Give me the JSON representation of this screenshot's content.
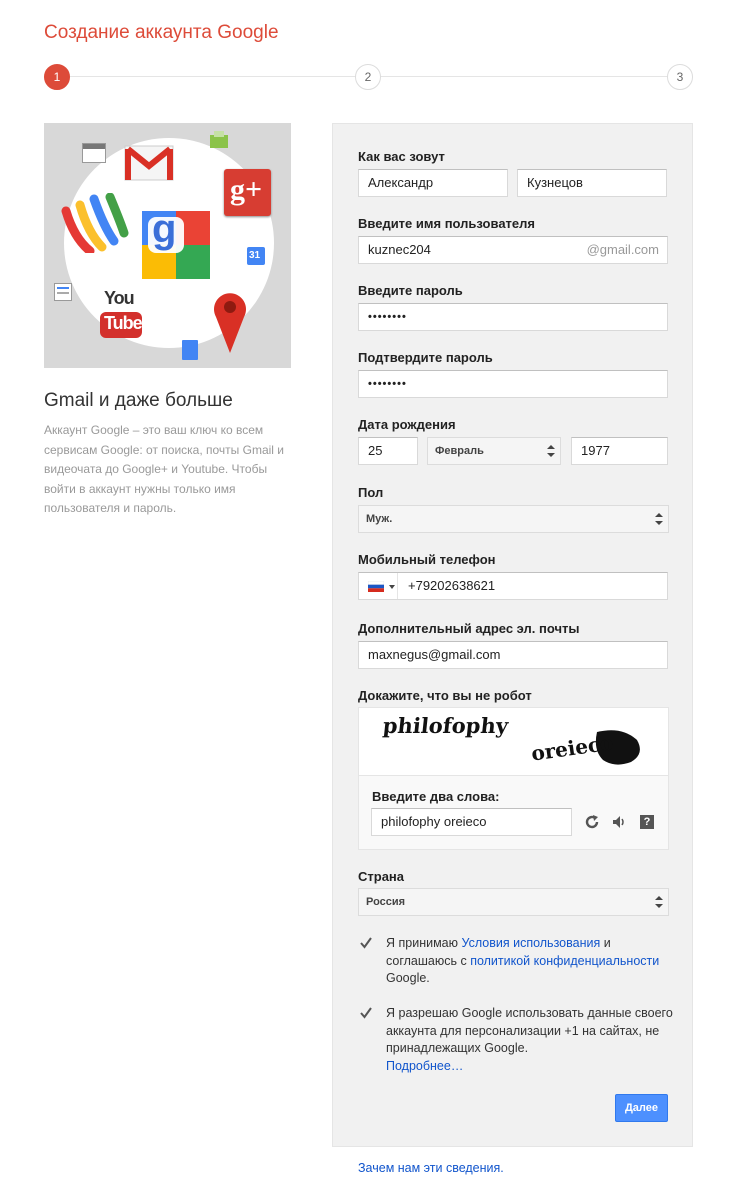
{
  "page": {
    "title": "Создание аккаунта Google"
  },
  "steps": [
    "1",
    "2",
    "3"
  ],
  "colors": {
    "accent": "#dd4b39",
    "link": "#1155cc",
    "button": "#4d90fe"
  },
  "hero": {
    "icons": [
      "calendar-icon",
      "gmail-icon",
      "drive-icon",
      "google-plus-icon",
      "wallet-icon",
      "google-g-icon",
      "calendar-31-icon",
      "docs-icon",
      "youtube-icon",
      "maps-pin-icon",
      "document-icon"
    ],
    "gplus_text": "g+",
    "g_text": "g",
    "cal_text": "31",
    "youtube_top": "You",
    "youtube_bottom": "Tube"
  },
  "side": {
    "heading": "Gmail и даже больше",
    "text": "Аккаунт Google – это ваш ключ ко всем сервисам Google: от поиска, почты Gmail и видеочата до Google+ и Youtube. Чтобы войти в аккаунт нужны только имя пользователя и пароль."
  },
  "form": {
    "name_label": "Как вас зовут",
    "first_name": "Александр",
    "last_name": "Кузнецов",
    "username_label": "Введите имя пользователя",
    "username": "kuznec204",
    "username_suffix": "@gmail.com",
    "password_label": "Введите пароль",
    "password": "••••••••",
    "confirm_label": "Подтвердите пароль",
    "confirm": "••••••••",
    "birth_label": "Дата рождения",
    "birth_day": "25",
    "birth_month": "Февраль",
    "birth_year": "1977",
    "gender_label": "Пол",
    "gender": "Муж.",
    "phone_label": "Мобильный телефон",
    "phone": "+79202638621",
    "email_label": "Дополнительный адрес эл. почты",
    "email": "maxnegus@gmail.com",
    "robot_label": "Докажите, что вы не робот",
    "captcha_word1": "philofophy",
    "captcha_word2": "oreieco",
    "captcha_prompt": "Введите два слова:",
    "captcha_value": "philofophy oreieco",
    "country_label": "Страна",
    "country": "Россия",
    "terms_1": "Я принимаю ",
    "terms_link1": "Условия использования",
    "terms_2": " и соглашаюсь с ",
    "terms_link2": "политикой конфиденциальности",
    "terms_3": " Google.",
    "plus_text": "Я разрешаю Google использовать данные своего аккаунта для персонализации +1 на сайтах, не принадлежащих Google.",
    "more_link": "Подробнее…",
    "next_button": "Далее"
  },
  "footer": {
    "why_link": "Зачем нам эти сведения."
  }
}
